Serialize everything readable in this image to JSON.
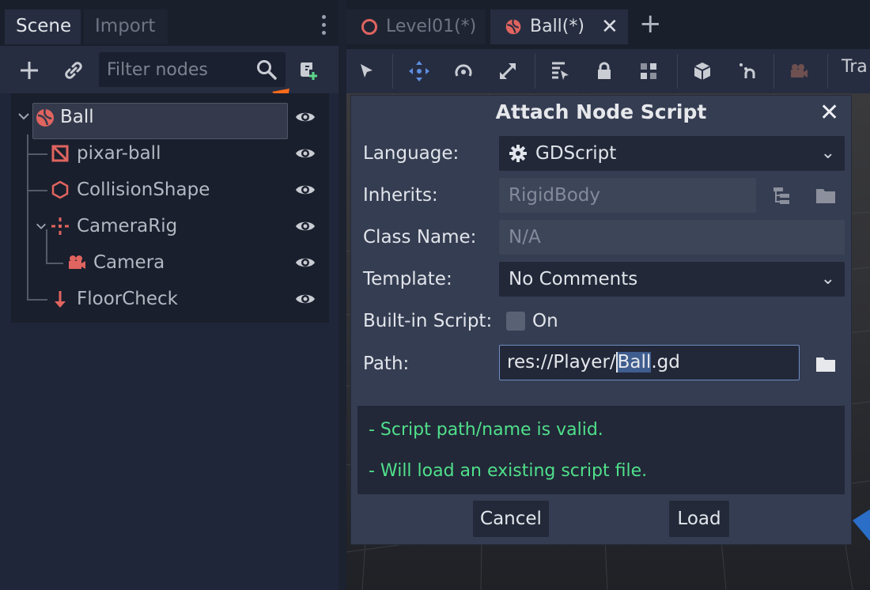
{
  "scene_dock": {
    "tabs": [
      "Scene",
      "Import"
    ],
    "filter_placeholder": "Filter nodes",
    "nodes": [
      {
        "label": "Ball",
        "icon": "rigid-body-ball-icon"
      },
      {
        "label": "pixar-ball",
        "icon": "mesh-instance-icon"
      },
      {
        "label": "CollisionShape",
        "icon": "collision-shape-icon"
      },
      {
        "label": "CameraRig",
        "icon": "spatial-node-icon"
      },
      {
        "label": "Camera",
        "icon": "camera-icon"
      },
      {
        "label": "FloorCheck",
        "icon": "raycast-icon"
      }
    ]
  },
  "editor": {
    "tabs": [
      "Level01(*)",
      "Ball(*)"
    ],
    "toolbar_text": "Tra"
  },
  "dialog": {
    "title": "Attach Node Script",
    "language_label": "Language:",
    "language_value": "GDScript",
    "inherits_label": "Inherits:",
    "inherits_value": "RigidBody",
    "class_name_label": "Class Name:",
    "class_name_value": "N/A",
    "template_label": "Template:",
    "template_value": "No Comments",
    "builtin_label": "Built-in Script:",
    "builtin_checkbox_label": "On",
    "builtin_checked": false,
    "path_label": "Path:",
    "path_prefix": "res://Player/",
    "path_selected": "Ball",
    "path_suffix": ".gd",
    "messages": [
      "- Script path/name is valid.",
      "- Will load an existing script file."
    ],
    "cancel_label": "Cancel",
    "load_label": "Load"
  },
  "colors": {
    "accent": "#ff6a1a",
    "valid_message": "#4fe08a",
    "node_icon_red": "#e0645f"
  }
}
